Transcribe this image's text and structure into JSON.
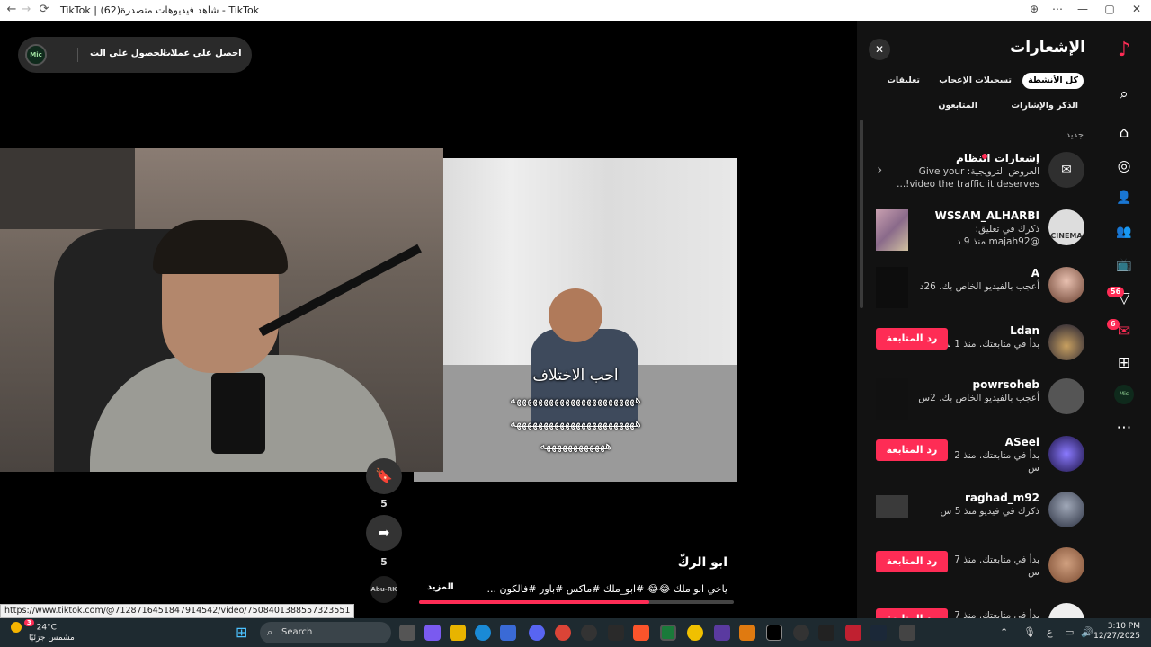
{
  "window": {
    "title": "TikTok | شاهد فيديوهات متصدرة(62) - TikTok",
    "back_icon": "←",
    "forward_icon": "→",
    "reload_icon": "⟳",
    "zoom_icon": "⊕",
    "menu_icon": "⋯",
    "minimize": "—",
    "restore": "▢",
    "close": "✕"
  },
  "promo": {
    "get_coins": "احصل على عملات",
    "get_app": "الحصول على الت...",
    "logo_text": "Mic"
  },
  "video": {
    "caption_line1": "احب الاختلاف",
    "caption_line2": "هههههههههههههههههههههههه",
    "caption_line3": "هههههههههههههههههههههههه",
    "caption_line4": "ههههههههههههه",
    "bookmark_icon": "🔖",
    "bookmark_count": "5",
    "share_icon": "➦",
    "share_count": "5",
    "author_badge": "Abu-RK",
    "author": "ابو الركّ",
    "description": "ياخي ابو ملك 😂😂 #ابو_ملك #ماكس #باور #فالكون ...",
    "more": "المزيد",
    "progress_percent": 73
  },
  "status_url": "https://www.tiktok.com/@7128716451847914542/video/7508401388557323551",
  "notifications": {
    "title": "الإشعارات",
    "close_icon": "✕",
    "filters": [
      "كل الأنشطة",
      "تسجيلات الإعجاب",
      "تعليقات",
      "الذكر والإشارات",
      "المتابعون"
    ],
    "section_new": "جديد",
    "items": [
      {
        "name": "إشعارات النظام",
        "line1": "العروض الترويجية: Give your",
        "line2": "video the traffic it deserves!...",
        "type": "system"
      },
      {
        "name": "WSSAM_ALHARBI",
        "line1": "ذكرك في تعليق:",
        "line2": "@majah92 منذ 9 د",
        "type": "thumb"
      },
      {
        "name": "A",
        "line1": "أعجب بالفيديو الخاص بك. 26د",
        "line2": "",
        "type": "thumb"
      },
      {
        "name": "Ldan",
        "line1": "بدأ في متابعتك. منذ 1 س",
        "line2": "",
        "type": "follow"
      },
      {
        "name": "powrsoheb",
        "line1": "أعجب بالفيديو الخاص بك. 2س",
        "line2": "",
        "type": "thumb"
      },
      {
        "name": "ASeel",
        "line1": "بدأ في متابعتك. منذ 2",
        "line2": "س",
        "type": "follow"
      },
      {
        "name": "raghad_m92",
        "line1": "ذكرك في فيديو منذ 5 س",
        "line2": "",
        "type": "thumb"
      },
      {
        "name": "",
        "line1": "بدأ في متابعتك. منذ 7",
        "line2": "س",
        "type": "follow"
      },
      {
        "name": "",
        "line1": "بدأ في متابعتك. منذ 7",
        "line2": "",
        "type": "follow"
      }
    ],
    "follow_back": "رد المتابعة",
    "chevron_icon": "›",
    "inbox_icon": "✉"
  },
  "rail": {
    "tiktok_icon": "♪",
    "search_icon": "⌕",
    "home_icon": "⌂",
    "explore_icon": "◎",
    "following_icon": "👤",
    "friends_icon": "👥",
    "live_icon": "📺",
    "activity_icon": "▽",
    "activity_badge": "56",
    "messages_icon": "✉",
    "messages_badge": "6",
    "upload_icon": "⊞",
    "profile_text": "Mic",
    "more_icon": "⋯"
  },
  "taskbar": {
    "weather_temp": "24°C",
    "weather_desc": "مشمس جزئيًا",
    "weather_badge": "3",
    "search": "Search",
    "start_icon": "⊞",
    "lang": "ع",
    "time": "3:10 PM",
    "date": "12/27/2025"
  }
}
